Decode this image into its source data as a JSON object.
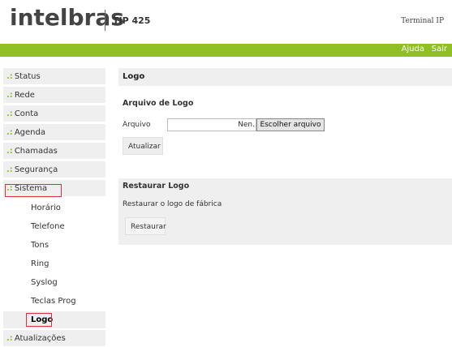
{
  "header": {
    "logo_text": "intelbras",
    "model": "TIP 425",
    "device_type": "Terminal IP",
    "brand_color": "#8fbf22"
  },
  "topbar": {
    "help_label": "Ajuda",
    "exit_label": "Sair"
  },
  "sidebar": {
    "prefix": ".:",
    "items": [
      {
        "label": "Status"
      },
      {
        "label": "Rede"
      },
      {
        "label": "Conta"
      },
      {
        "label": "Agenda"
      },
      {
        "label": "Chamadas"
      },
      {
        "label": "Segurança"
      },
      {
        "label": "Sistema"
      }
    ],
    "subitems": [
      {
        "label": "Horário"
      },
      {
        "label": "Telefone"
      },
      {
        "label": "Tons"
      },
      {
        "label": "Ring"
      },
      {
        "label": "Syslog"
      },
      {
        "label": "Teclas Prog"
      },
      {
        "label": "Logo"
      }
    ],
    "last_item": {
      "label": "Atualizações"
    },
    "highlight_color": "#d9313b"
  },
  "main": {
    "title": "Logo",
    "upload": {
      "title": "Arquivo de Logo",
      "field_label": "Arquivo",
      "file_value": "Nen.",
      "choose_button": "Escolher arquivo",
      "update_button": "Atualizar"
    },
    "restore": {
      "title": "Restaurar Logo",
      "description": "Restaurar o logo de fábrica",
      "button": "Restaurar"
    }
  }
}
